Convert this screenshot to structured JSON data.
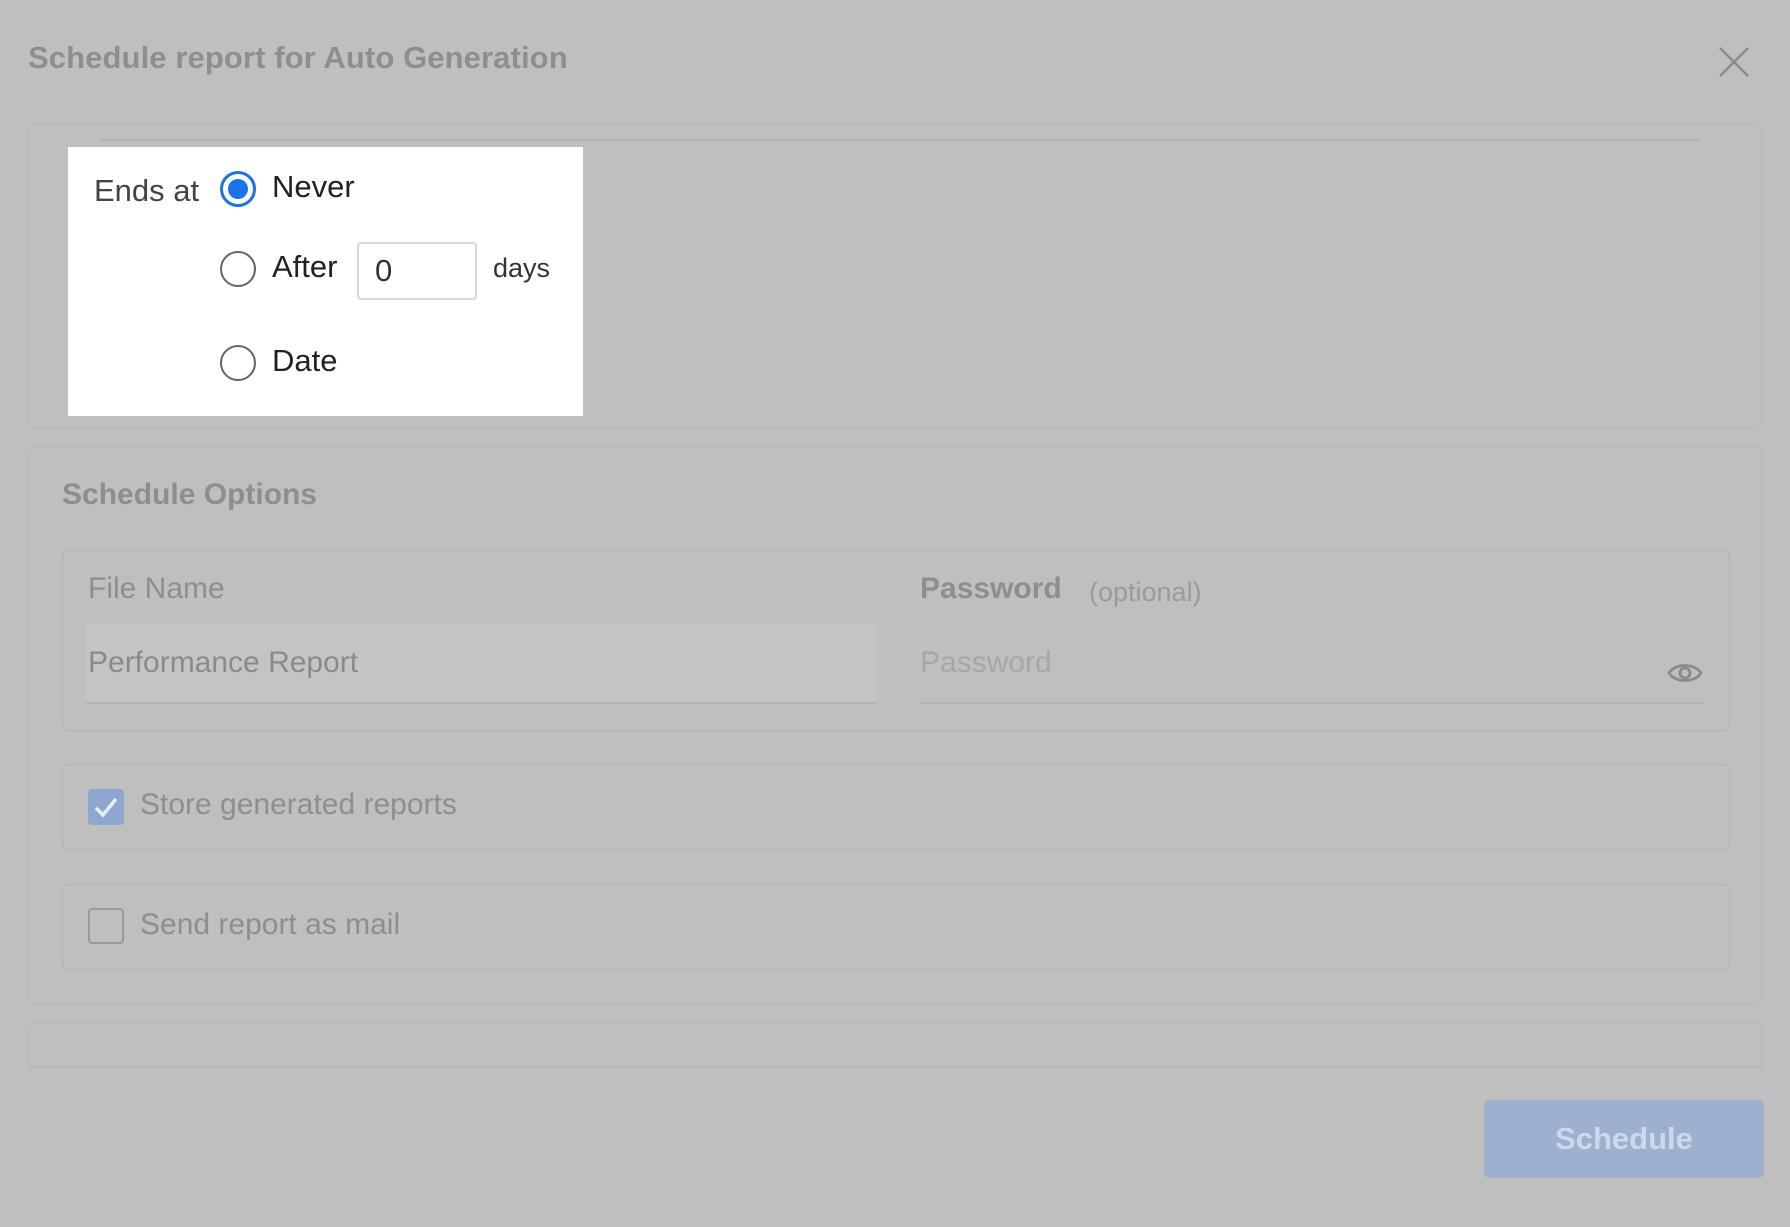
{
  "dialog": {
    "title": "Schedule report for Auto Generation",
    "close_icon": "close-icon"
  },
  "ends_at": {
    "label": "Ends at",
    "options": [
      {
        "label": "Never",
        "selected": true
      },
      {
        "label": "After",
        "selected": false
      },
      {
        "label": "Date",
        "selected": false
      }
    ],
    "after_days_value": "0",
    "days_unit": "days",
    "accent_color": "#1a73e8"
  },
  "schedule_options": {
    "title": "Schedule Options",
    "file_name": {
      "label": "File Name",
      "value": "Performance Report"
    },
    "password": {
      "label": "Password",
      "optional_hint": "(optional)",
      "placeholder": "Password",
      "reveal_icon": "eye-icon"
    },
    "store_reports": {
      "label": "Store generated reports",
      "checked": true,
      "check_icon": "checkmark-icon"
    },
    "send_mail": {
      "label": "Send report as mail",
      "checked": false
    }
  },
  "footer": {
    "schedule_label": "Schedule"
  }
}
